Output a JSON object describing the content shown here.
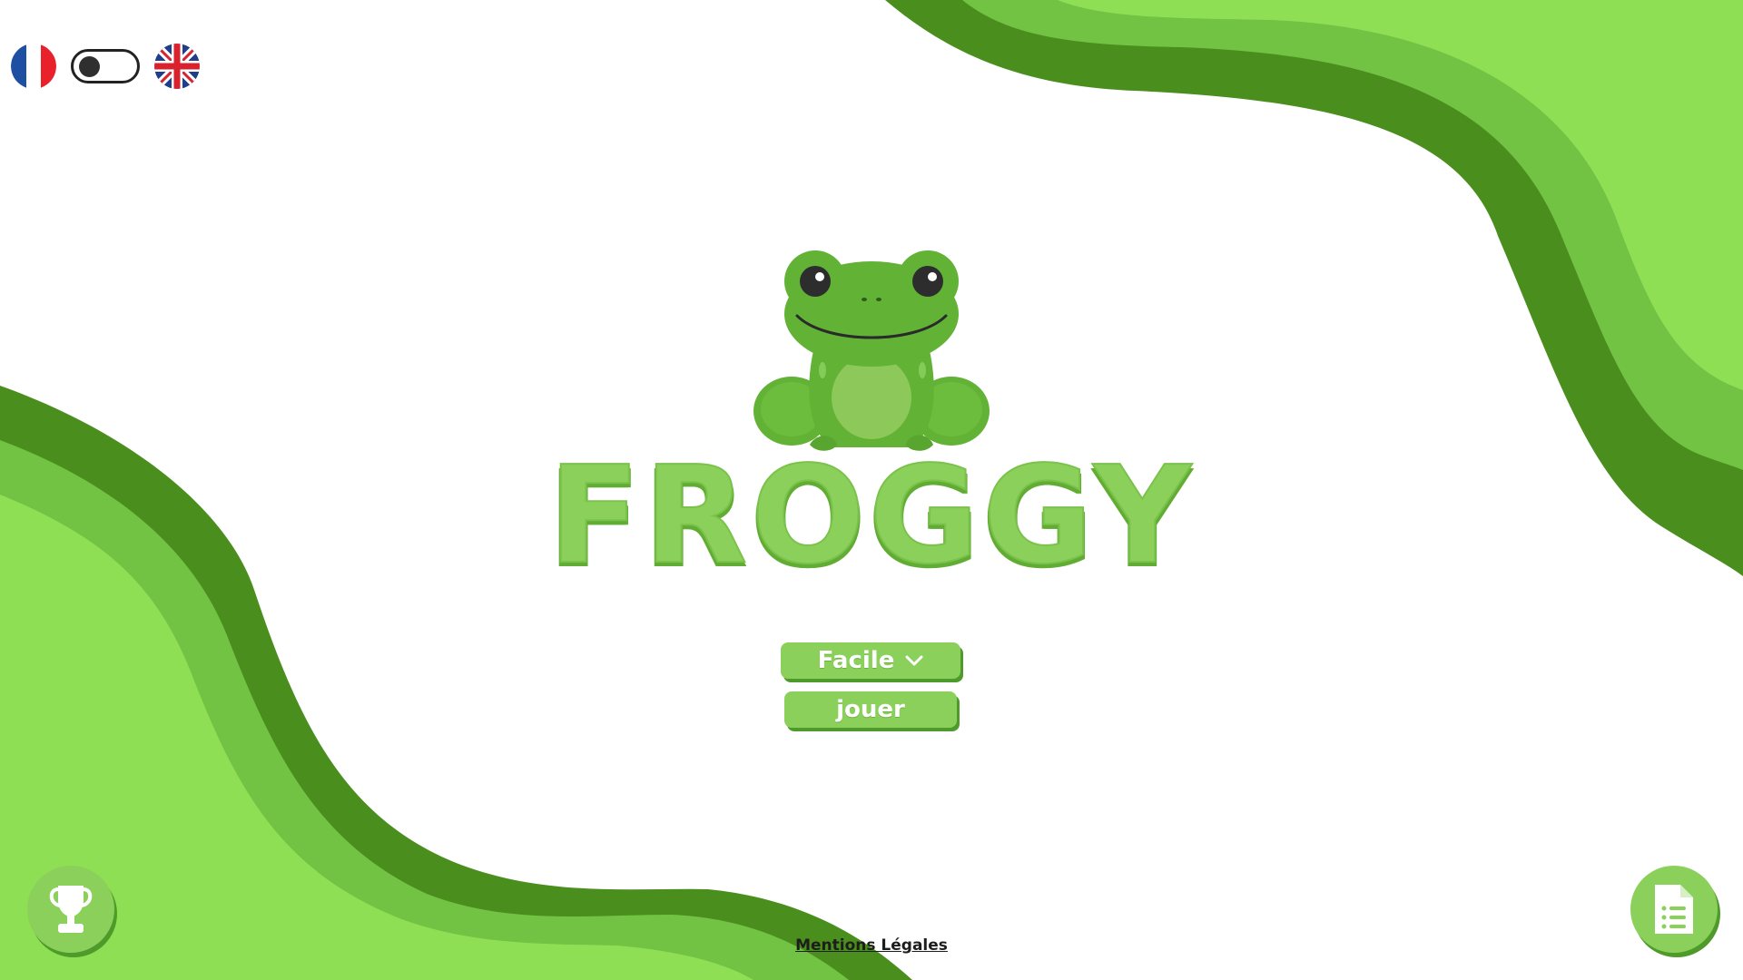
{
  "game": {
    "title": "FROGGY",
    "difficulty_label": "Facile",
    "play_label": "jouer",
    "legal_label": "Mentions Légales"
  },
  "language": {
    "current": "fr",
    "options": [
      "fr",
      "en"
    ]
  },
  "icons": {
    "difficulty_dropdown": "chevron-down-icon",
    "leaderboard": "trophy-icon",
    "rules": "document-list-icon"
  },
  "colors": {
    "light_green": "#8fdf55",
    "mid_green": "#72c244",
    "dark_green": "#4a8e1d",
    "button_green": "#8bd05b",
    "frog_body": "#62b236",
    "frog_belly": "#8cc95a"
  }
}
